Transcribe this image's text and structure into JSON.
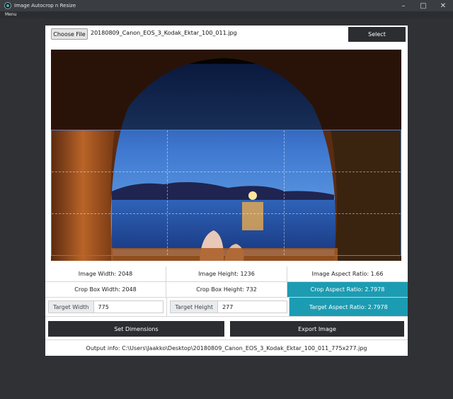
{
  "window": {
    "title": "Image Autocrop n Resize",
    "minimize": "–",
    "maximize": "□",
    "close": "✕"
  },
  "menu": {
    "label": "Menu"
  },
  "file": {
    "choose_label": "Choose File",
    "filename": "20180809_Canon_EOS_3_Kodak_Ektar_100_011.jpg",
    "select_label": "Select"
  },
  "info": {
    "image_width": "Image Width: 2048",
    "image_height": "Image Height: 1236",
    "image_aspect": "Image Aspect Ratio: 1.66",
    "crop_width": "Crop Box Width: 2048",
    "crop_height": "Crop Box Height: 732",
    "crop_aspect": "Crop Aspect Ratio: 2.7978"
  },
  "target": {
    "width_label": "Target Width",
    "width_value": "775",
    "height_label": "Target Height",
    "height_value": "277",
    "aspect": "Target Aspect Ratio: 2.7978"
  },
  "actions": {
    "set_dimensions": "Set Dimensions",
    "export_image": "Export Image"
  },
  "output": {
    "text": "Output info: C:\\Users\\Jaakko\\Desktop\\20180809_Canon_EOS_3_Kodak_Ektar_100_011_775x277.jpg"
  },
  "colors": {
    "accent_teal": "#1c9cb2",
    "dark_button": "#2b2d31",
    "window_bg": "#2f3135"
  }
}
